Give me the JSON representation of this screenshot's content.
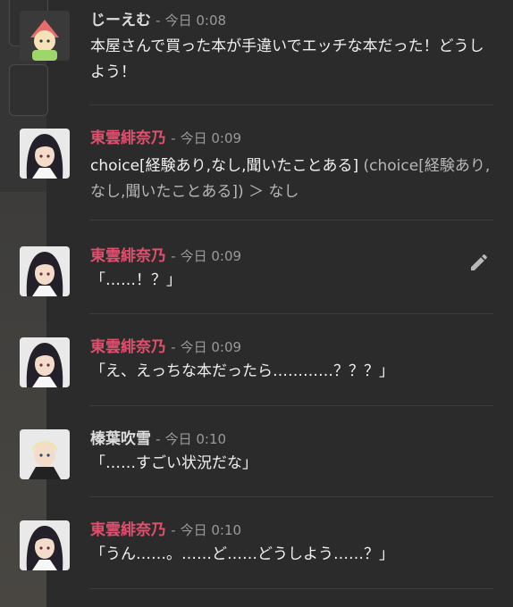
{
  "messages": [
    {
      "author": "じーえむ",
      "sep": "-",
      "time": "今日 0:08",
      "text": "本屋さんで買った本が手違いでエッチな本だった！どうしよう！"
    },
    {
      "author": "東雲緋奈乃",
      "sep": "-",
      "time": "今日 0:09",
      "text": "choice[経験あり,なし,聞いたことある]",
      "text_dim": " (choice[経験あり,なし,聞いたことある]) ＞ なし"
    },
    {
      "author": "東雲緋奈乃",
      "sep": "-",
      "time": "今日 0:09",
      "text": "「……！？」"
    },
    {
      "author": "東雲緋奈乃",
      "sep": "-",
      "time": "今日 0:09",
      "text": "「え、えっちな本だったら…………？？？」"
    },
    {
      "author": "榛葉吹雪",
      "sep": "-",
      "time": "今日 0:10",
      "text": "「……すごい状況だな」"
    },
    {
      "author": "東雲緋奈乃",
      "sep": "-",
      "time": "今日 0:10",
      "text": "「うん……。……ど……どうしよう……？」"
    }
  ],
  "icons": {
    "edit": "pencil-icon"
  },
  "colors": {
    "background": "#2b2b2b",
    "author_highlight": "#e0506e",
    "timestamp": "#9a9a9a"
  }
}
